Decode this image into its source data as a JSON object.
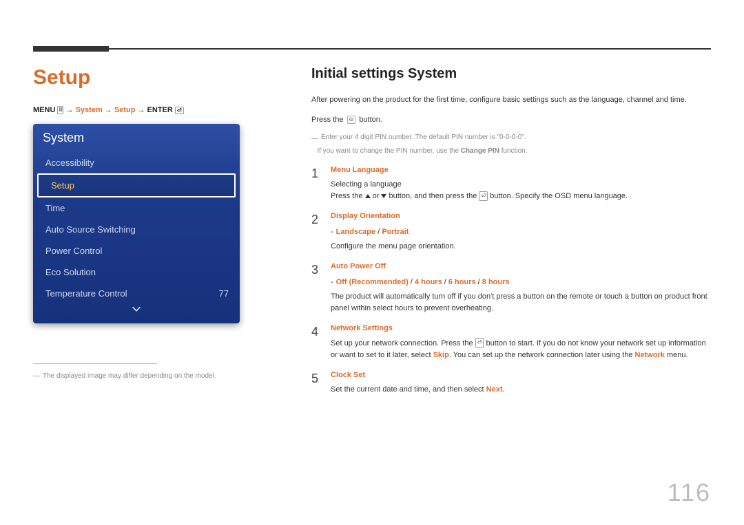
{
  "page_number": "116",
  "left": {
    "title": "Setup",
    "breadcrumb": {
      "prefix": "MENU",
      "menu_icon": "Ⅲ",
      "arrow": " → ",
      "p1": "System",
      "p2": "Setup",
      "suffix": "ENTER",
      "enter_icon": "⏎"
    },
    "menu": {
      "header": "System",
      "items": [
        {
          "label": "Accessibility",
          "value": "",
          "selected": false
        },
        {
          "label": "Setup",
          "value": "",
          "selected": true
        },
        {
          "label": "Time",
          "value": "",
          "selected": false
        },
        {
          "label": "Auto Source Switching",
          "value": "",
          "selected": false
        },
        {
          "label": "Power Control",
          "value": "",
          "selected": false
        },
        {
          "label": "Eco Solution",
          "value": "",
          "selected": false
        },
        {
          "label": "Temperature Control",
          "value": "77",
          "selected": false
        }
      ]
    },
    "footnote": "The displayed image may differ depending on the model."
  },
  "right": {
    "heading": "Initial settings System",
    "intro1": "After powering on the product for the first time, configure basic settings such as the language, channel and time.",
    "intro2a": "Press the ",
    "intro2_icon": "⊙",
    "intro2b": " button.",
    "pin_note1": "Enter your 4 digit PIN number. The default PIN number is \"0-0-0-0\".",
    "pin_note2a": "If you want to change the PIN number, use the ",
    "pin_note2b": "Change PIN",
    "pin_note2c": " function.",
    "steps": [
      {
        "num": "1",
        "title": "Menu Language",
        "body_plain1": "Selecting a language",
        "body2a": "Press the ",
        "body2b": " or ",
        "body2c": " button, and then press the ",
        "body2d": " button. Specify the OSD menu language."
      },
      {
        "num": "2",
        "title": "Display Orientation",
        "sub_a": "Landscape",
        "sub_sep": " / ",
        "sub_b": "Portrait",
        "body_plain1": "Configure the menu page orientation."
      },
      {
        "num": "3",
        "title": "Auto Power Off",
        "sub_a": "Off (Recommended)",
        "sub_sep": " / ",
        "sub_b": "4 hours",
        "sub_c": "6 hours",
        "sub_d": "8 hours",
        "body_plain1": "The product will automatically turn off if you don't press a button on the remote or touch a button on product front panel within select hours to prevent overheating."
      },
      {
        "num": "4",
        "title": "Network Settings",
        "body4a": "Set up your network connection. Press the ",
        "body4b": " button to start. If you do not know your network set up information or want to set to it later, select ",
        "body4_skip": "Skip",
        "body4c": ". You can set up the network connection later using the ",
        "body4_net": "Network",
        "body4d": " menu."
      },
      {
        "num": "5",
        "title": "Clock Set",
        "body5a": "Set the current date and time, and then select ",
        "body5_next": "Next",
        "body5b": "."
      }
    ]
  }
}
